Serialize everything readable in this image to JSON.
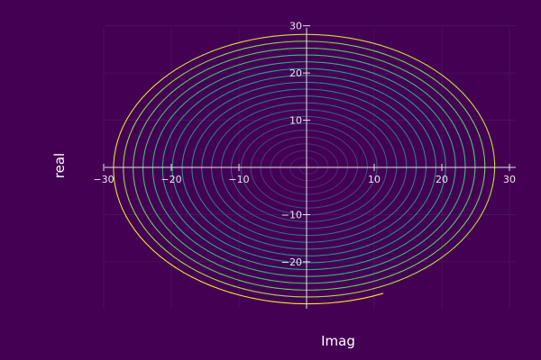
{
  "chart_data": {
    "type": "line",
    "title": "",
    "xlabel": "Imag",
    "ylabel": "real",
    "xlim": [
      -30,
      30
    ],
    "ylim": [
      -30,
      30
    ],
    "axis_style": "origin-centered",
    "grid": true,
    "legend": "none",
    "colormap": "viridis",
    "colors": {
      "background": "#440154",
      "axis": "#e6e6e6",
      "grid": "#5a2a6a"
    },
    "x_ticks": [
      "−30",
      "−20",
      "−10",
      "10",
      "20",
      "30"
    ],
    "x_tick_values": [
      -30,
      -20,
      -10,
      10,
      20,
      30
    ],
    "y_ticks": [
      "30",
      "20",
      "10",
      "−10",
      "−20"
    ],
    "y_tick_values": [
      30,
      20,
      10,
      -10,
      -20
    ],
    "series": [
      {
        "shape": "spiral",
        "center": [
          0,
          0
        ],
        "start_radius": 0,
        "end_radius": 29,
        "turns": 20,
        "end_point": [
          11.7,
          -27.7
        ]
      }
    ]
  }
}
